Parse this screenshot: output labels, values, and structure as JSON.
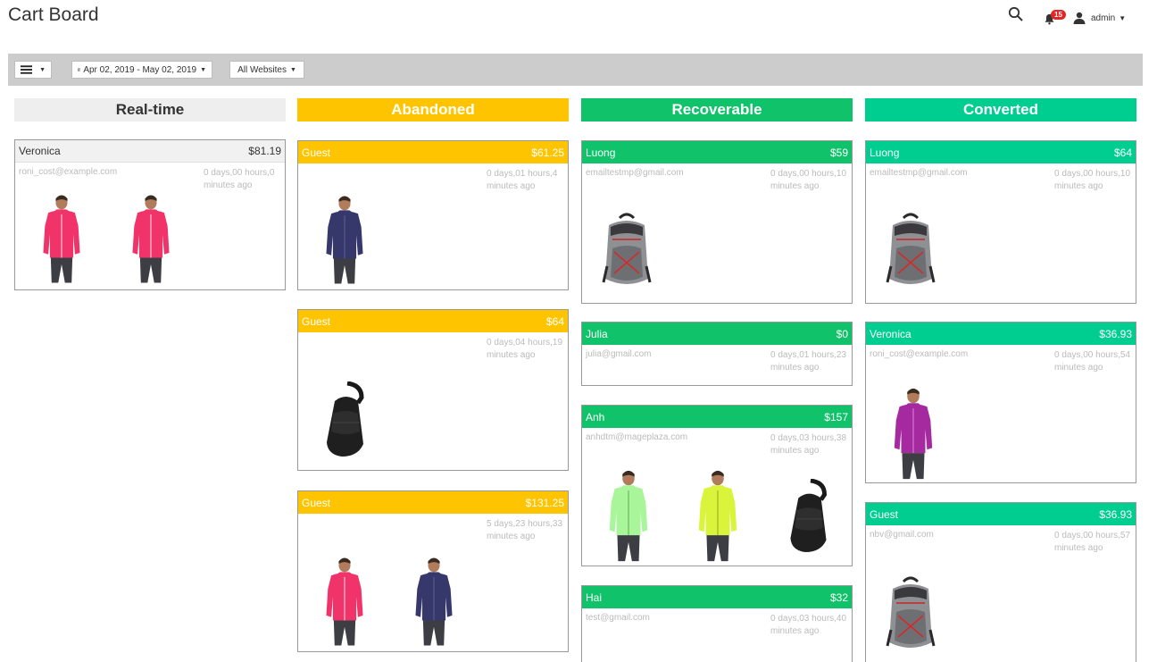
{
  "header": {
    "title": "Cart Board",
    "notifications_count": "15",
    "user": "admin"
  },
  "toolbar": {
    "date_range": "Apr 02, 2019 - May 02, 2019",
    "website": "All Websites"
  },
  "colors": {
    "abandoned": "#ffc400",
    "recoverable": "#10c269",
    "converted": "#00ce91",
    "realtime": "#eeeeee"
  },
  "columns": [
    {
      "title": "Real-time",
      "cards": [
        {
          "name": "Veronica",
          "total": "$81.19",
          "email": "roni_cost@example.com",
          "time": "0 days,00 hours,0 minutes ago",
          "products": [
            "pink-jacket",
            "pink-jacket"
          ]
        }
      ]
    },
    {
      "title": "Abandoned",
      "cards": [
        {
          "name": "Guest",
          "total": "$61.25",
          "email": "",
          "time": "0 days,01 hours,4 minutes ago",
          "products": [
            "navy-jacket"
          ]
        },
        {
          "name": "Guest",
          "total": "$64",
          "email": "",
          "time": "0 days,04 hours,19 minutes ago",
          "products": [
            "black-bag"
          ]
        },
        {
          "name": "Guest",
          "total": "$131.25",
          "email": "",
          "time": "5 days,23 hours,33 minutes ago",
          "products": [
            "pink-jacket",
            "navy-jacket"
          ]
        }
      ]
    },
    {
      "title": "Recoverable",
      "cards": [
        {
          "name": "Luong",
          "total": "$59",
          "email": "emailtestmp@gmail.com",
          "time": "0 days,00 hours,10 minutes ago",
          "products": [
            "backpack"
          ]
        },
        {
          "name": "Julia",
          "total": "$0",
          "email": "julia@gmail.com",
          "time": "0 days,01 hours,23 minutes ago",
          "products": []
        },
        {
          "name": "Anh",
          "total": "$157",
          "email": "anhdtm@mageplaza.com",
          "time": "0 days,03 hours,38 minutes ago",
          "products": [
            "green-jacket",
            "lime-jacket",
            "black-bag"
          ]
        },
        {
          "name": "Hai",
          "total": "$32",
          "email": "test@gmail.com",
          "time": "0 days,03 hours,40 minutes ago",
          "products": []
        }
      ]
    },
    {
      "title": "Converted",
      "cards": [
        {
          "name": "Luong",
          "total": "$64",
          "email": "emailtestmp@gmail.com",
          "time": "0 days,00 hours,10 minutes ago",
          "products": [
            "backpack"
          ]
        },
        {
          "name": "Veronica",
          "total": "$36.93",
          "email": "roni_cost@example.com",
          "time": "0 days,00 hours,54 minutes ago",
          "products": [
            "purple-jacket"
          ]
        },
        {
          "name": "Guest",
          "total": "$36.93",
          "email": "nbv@gmail.com",
          "time": "0 days,00 hours,57 minutes ago",
          "products": [
            "backpack"
          ]
        }
      ]
    }
  ]
}
